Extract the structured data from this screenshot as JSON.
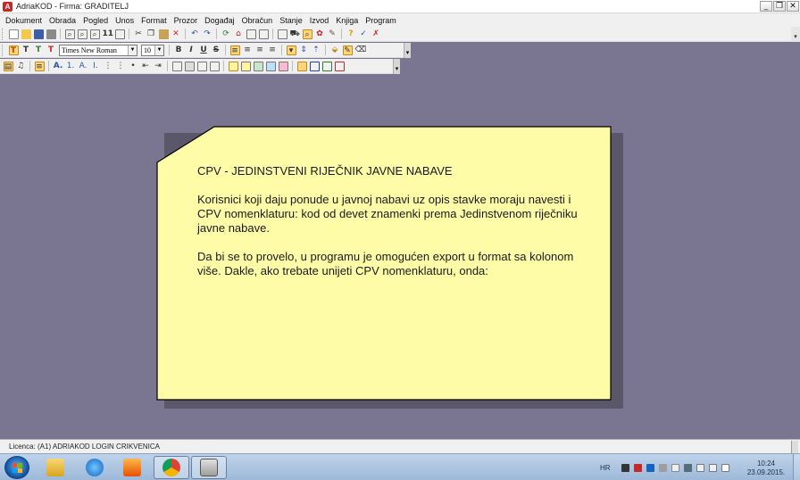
{
  "window": {
    "title": "AdriaKOD - Firma: GRADITELJ",
    "app_icon": "adriakod-app-icon",
    "controls": [
      "minimize",
      "restore",
      "close"
    ]
  },
  "menu": [
    "Dokument",
    "Obrada",
    "Pogled",
    "Unos",
    "Format",
    "Prozor",
    "Događaj",
    "Obračun",
    "Stanje",
    "Izvod",
    "Knjiga",
    "Program"
  ],
  "toolbar_format": {
    "font_name": "Times New Roman",
    "font_size": "10"
  },
  "note": {
    "background": "#fffca8",
    "heading": "CPV - JEDINSTVENI RIJEČNIK JAVNE NABAVE",
    "paragraph1": "Korisnici koji daju ponude u javnoj nabavi uz opis stavke moraju navesti i CPV nomenklaturu: kod od devet znamenki prema Jedinstvenom riječniku javne nabave.",
    "paragraph2": "Da bi se to provelo, u programu je omogućen export u format sa kolonom više. Dakle, ako trebate unijeti CPV nomenklaturu, onda:"
  },
  "status": {
    "licence": "Licenca:  (A1) ADRIAKOD LOGIN CRIKVENICA"
  },
  "taskbar": {
    "pinned": [
      "explorer-icon",
      "internet-explorer-icon",
      "media-player-icon",
      "chrome-icon",
      "adriakod-icon"
    ],
    "language": "HR",
    "time": "10:24",
    "date": "23.09.2015."
  },
  "colors": {
    "workspace": "#7a7590",
    "note_fill": "#fffca8",
    "note_shadow": "#5b576b"
  }
}
